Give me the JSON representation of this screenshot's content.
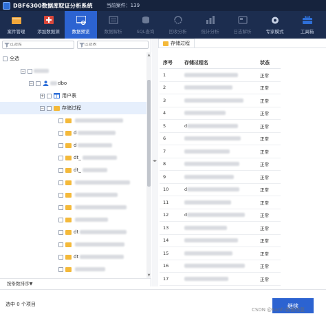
{
  "titlebar": {
    "app_title": "DBF6300数据库取证分析系统",
    "case_label": "当前案件：139"
  },
  "toolbar": {
    "items": [
      {
        "label": "案件管理",
        "icon": "folder-icon",
        "state": "normal"
      },
      {
        "label": "添加数据源",
        "icon": "add-datasource-icon",
        "state": "normal"
      },
      {
        "label": "数据预览",
        "icon": "preview-icon",
        "state": "active"
      },
      {
        "label": "数据解析",
        "icon": "parse-icon",
        "state": "disabled"
      },
      {
        "label": "SQL查询",
        "icon": "sql-icon",
        "state": "disabled"
      },
      {
        "label": "回收分析",
        "icon": "recycle-icon",
        "state": "disabled"
      },
      {
        "label": "统计分析",
        "icon": "statistics-icon",
        "state": "disabled"
      },
      {
        "label": "日志解析",
        "icon": "log-icon",
        "state": "disabled"
      },
      {
        "label": "专家模式",
        "icon": "expert-icon",
        "state": "normal"
      },
      {
        "label": "工具箱",
        "icon": "toolbox-icon",
        "state": "normal"
      }
    ]
  },
  "left": {
    "filter1_placeholder": "过滤库",
    "filter2_placeholder": "过滤表",
    "select_all": "全选",
    "schema_suffix": "dbo",
    "user_tables": "用户表",
    "stored_procs": "存储过程",
    "sort_label": "按条数排序▼",
    "proc_prefixes": [
      "",
      "d",
      "d",
      "dt_",
      "dt_",
      "",
      "",
      "",
      "",
      "dt",
      "",
      "dt",
      "",
      "dt"
    ]
  },
  "right": {
    "tab_label": "存储过程",
    "columns": [
      "序号",
      "存储过程名",
      "状态"
    ],
    "rows": [
      {
        "no": "1",
        "prefix": "",
        "status": "正常"
      },
      {
        "no": "2",
        "prefix": "",
        "status": "正常"
      },
      {
        "no": "3",
        "prefix": "",
        "status": "正常"
      },
      {
        "no": "4",
        "prefix": "",
        "status": "正常"
      },
      {
        "no": "5",
        "prefix": "d",
        "status": "正常"
      },
      {
        "no": "6",
        "prefix": "",
        "status": "正常"
      },
      {
        "no": "7",
        "prefix": "",
        "status": "正常"
      },
      {
        "no": "8",
        "prefix": "",
        "status": "正常"
      },
      {
        "no": "9",
        "prefix": "",
        "status": "正常"
      },
      {
        "no": "10",
        "prefix": "d",
        "status": "正常"
      },
      {
        "no": "11",
        "prefix": "",
        "status": "正常"
      },
      {
        "no": "12",
        "prefix": "d",
        "status": "正常"
      },
      {
        "no": "13",
        "prefix": "",
        "status": "正常"
      },
      {
        "no": "14",
        "prefix": "",
        "status": "正常"
      },
      {
        "no": "15",
        "prefix": "",
        "status": "正常"
      },
      {
        "no": "16",
        "prefix": "",
        "status": "正常"
      },
      {
        "no": "17",
        "prefix": "",
        "status": "正常"
      }
    ]
  },
  "status": {
    "selected": "选中 0 个项目",
    "continue": "继续",
    "watermark": "CSDN @Sanfu数据恢复"
  }
}
